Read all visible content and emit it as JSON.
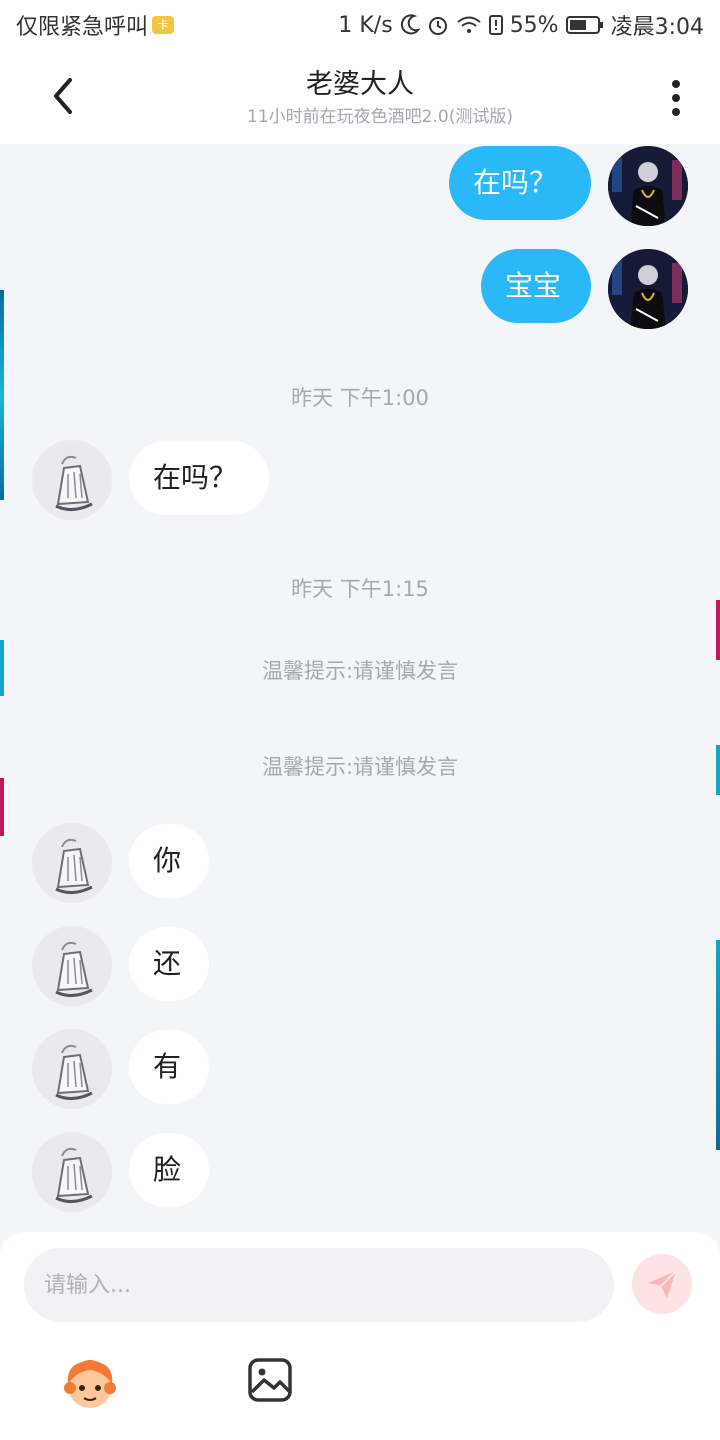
{
  "status_bar": {
    "carrier": "仅限紧急呼叫",
    "sim_icon": "sim-card-icon",
    "speed": "1 K/s",
    "battery": "55%",
    "time": "凌晨3:04"
  },
  "header": {
    "title": "老婆大人",
    "subtitle": "11小时前在玩夜色酒吧2.0(测试版)"
  },
  "messages": [
    {
      "side": "self",
      "text": "在吗？"
    },
    {
      "side": "self",
      "text": "宝宝"
    },
    {
      "type": "time",
      "text": "昨天 下午1:00"
    },
    {
      "side": "other",
      "text": "在吗？"
    },
    {
      "type": "time",
      "text": "昨天 下午1:15"
    },
    {
      "type": "notice",
      "text": "温馨提示:请谨慎发言"
    },
    {
      "type": "notice",
      "text": "温馨提示:请谨慎发言"
    },
    {
      "side": "other",
      "text": "你"
    },
    {
      "side": "other",
      "text": "还"
    },
    {
      "side": "other",
      "text": "有"
    },
    {
      "side": "other",
      "text": "脸"
    }
  ],
  "composer": {
    "placeholder": "请输入...",
    "send_icon": "paper-plane-icon",
    "emoji_icon": "sticker-icon",
    "image_icon": "image-icon"
  },
  "colors": {
    "self_bubble": "#2ab8f9",
    "other_bubble": "#ffffff",
    "chat_background": "#f4f5f9",
    "send_button": "#fde3e3"
  }
}
